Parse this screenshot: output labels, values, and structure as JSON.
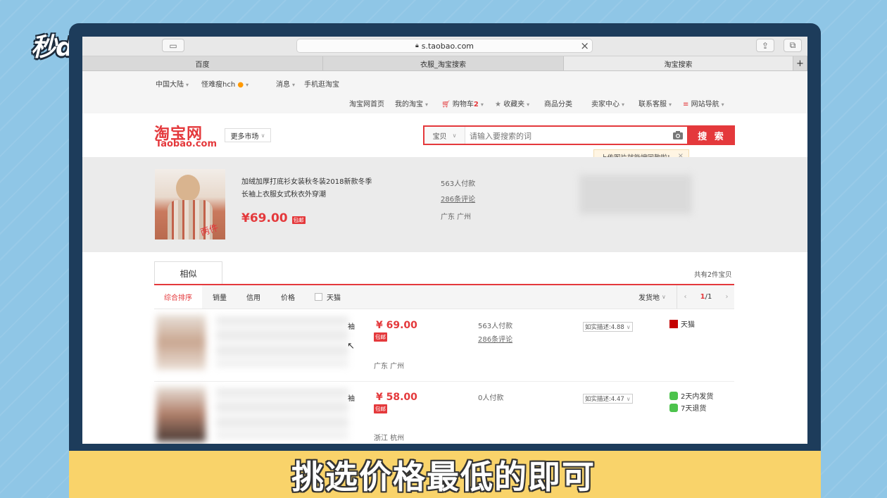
{
  "overlay": {
    "logo_text": "秒dong视频",
    "subtitle": "挑选价格最低的即可"
  },
  "browser": {
    "url": "s.taobao.com",
    "tabs": [
      "百度",
      "衣服_淘宝搜索",
      "淘宝搜索"
    ],
    "active_tab": 2
  },
  "topnav": {
    "region": "中国大陆",
    "user": "怪难瘦hch",
    "messages": "消息",
    "mobile": "手机逛淘宝",
    "links": [
      "淘宝网首页",
      "我的淘宝",
      "购物车",
      "收藏夹",
      "商品分类",
      "卖家中心",
      "联系客服",
      "网站导航"
    ],
    "cart_count": "2"
  },
  "header": {
    "logo_cn": "淘宝网",
    "logo_en": "Taobao.com",
    "more_market": "更多市场",
    "search_category": "宝贝",
    "search_placeholder": "请输入要搜索的词",
    "search_button": "搜 索",
    "tip": "上传图片就能搜同款啦!"
  },
  "product": {
    "title": "加绒加厚打底衫女装秋冬装2018新款冬季长袖上衣服女式秋衣外穿潮",
    "price": "¥69.00",
    "badge": "包邮",
    "sales": "563人付款",
    "reviews": "286条评论",
    "location": "广东 广州",
    "img_tag": "两件"
  },
  "results": {
    "tab_label": "相似",
    "total": "共有2件宝贝",
    "sort": [
      "综合排序",
      "销量",
      "信用",
      "价格"
    ],
    "tmall_filter": "天猫",
    "ship_from": "发货地",
    "page": "1",
    "page_total": "/1",
    "rows": [
      {
        "title_tail": "袖",
        "price": "¥ 69.00",
        "badge": "包邮",
        "sales": "563人付款",
        "reviews": "286条评论",
        "location": "广东 广州",
        "desc": "如实描述:4.88",
        "services": [
          "天猫"
        ]
      },
      {
        "title_tail": "袖",
        "price": "¥ 58.00",
        "badge": "包邮",
        "sales": "0人付款",
        "reviews": "",
        "location": "浙江 杭州",
        "desc": "如实描述:4.47",
        "services": [
          "2天内发货",
          "7天退货"
        ]
      }
    ]
  },
  "colors": {
    "accent": "#e4393c",
    "frame": "#1d3c5b",
    "background": "#8fc6e6",
    "subtitle_bar": "#f9d36a"
  }
}
